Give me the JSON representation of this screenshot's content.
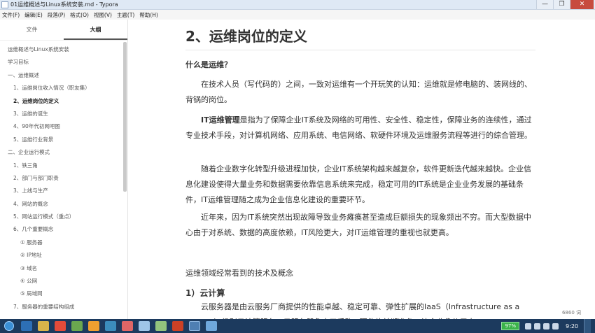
{
  "window": {
    "title": "01运维概述与Linux系统安装.md - Typora",
    "controls": [
      "—",
      "❐",
      "✕"
    ]
  },
  "menu": [
    "文件(F)",
    "编辑(E)",
    "段落(P)",
    "格式(O)",
    "视图(V)",
    "主题(T)",
    "帮助(H)"
  ],
  "sidebar": {
    "tabs": [
      "文件",
      "大纲"
    ],
    "active_tab": 1,
    "outline": [
      {
        "label": "运维概述与Linux系统安装",
        "level": 0
      },
      {
        "label": "学习目标",
        "level": 0
      },
      {
        "label": "一、运维概述",
        "level": 1
      },
      {
        "label": "1、运维岗位收入情况（职友集）",
        "level": 2
      },
      {
        "label": "2、运维岗位的定义",
        "level": 2,
        "active": true
      },
      {
        "label": "3、运维的诞生",
        "level": 2
      },
      {
        "label": "4、90年代初网吧图",
        "level": 2
      },
      {
        "label": "5、运维行业背景",
        "level": 2
      },
      {
        "label": "二、企业运行模式",
        "level": 1
      },
      {
        "label": "1、铁三角",
        "level": 2
      },
      {
        "label": "2、部门与部门职责",
        "level": 2
      },
      {
        "label": "3、上线与生产",
        "level": 2
      },
      {
        "label": "4、网站的概念",
        "level": 2
      },
      {
        "label": "5、网站运行模式（重点）",
        "level": 2
      },
      {
        "label": "6、几个重要概念",
        "level": 2
      },
      {
        "label": "① 服务器",
        "level": 3
      },
      {
        "label": "② IP地址",
        "level": 3
      },
      {
        "label": "③ 域名",
        "level": 3
      },
      {
        "label": "④ 公网",
        "level": 3
      },
      {
        "label": "⑤ 局域网",
        "level": 3
      },
      {
        "label": "7、服务器的重要结构组成",
        "level": 2
      }
    ],
    "footer": [
      "<",
      "</>"
    ]
  },
  "document": {
    "h2": "2、运维岗位的定义",
    "h4": "什么是运维？",
    "p1": "在技术人员（写代码的）之间，一致对运维有一个开玩笑的认知：运维就是修电脑的、装网线的、背锅的岗位。",
    "p2_bold": "IT运维管理",
    "p2_rest": "是指为了保障企业IT系统及网络的可用性、安全性、稳定性，保障业务的连续性，通过专业技术手段，对计算机网络、应用系统、电信网络、软硬件环境及运维服务流程等进行的综合管理。",
    "p3": "随着企业数字化转型升级进程加快，企业IT系统架构越来越复杂，软件更新迭代越来越快。企业信息化建设使得大量业务和数据需要依靠信息系统来完成，稳定可用的IT系统是企业业务发展的基础条件，IT运维管理随之成为企业信息化建设的重要环节。",
    "p4": "近年来，因为IT系统突然出现故障导致业务瘫痪甚至造成巨额损失的现象频出不穷。而大型数据中心由于对系统、数据的高度依赖，IT风险更大，对IT运维管理的重视也就更高。",
    "section_text": "运维领域经常看到的技术及概念",
    "h3": "1）云计算",
    "p5": "云服务器是由云服务厂商提供的性能卓越、稳定可靠、弹性扩展的IaaS（Infrastructure as a Service）级别云计算服务。云服务器免去了采购IT硬件的前期准备，让企业像使用水",
    "word_count": "6860 词"
  },
  "taskbar": {
    "battery": "97%",
    "clock": "9:20"
  }
}
